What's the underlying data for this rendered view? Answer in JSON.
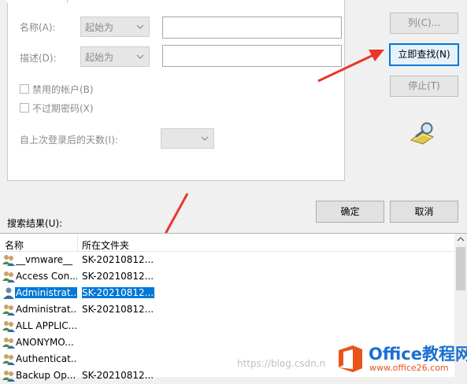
{
  "search_form": {
    "name_label": "名称(A):",
    "desc_label": "描述(D):",
    "name_mode": "起始为",
    "desc_mode": "起始为",
    "name_value": "",
    "desc_value": "",
    "disabled_accounts": "禁用的帐户(B)",
    "non_expiring_pwd": "不过期密码(X)",
    "days_since_login_label": "自上次登录后的天数(I):",
    "days_value": ""
  },
  "side_buttons": {
    "columns": "列(C)...",
    "find_now": "立即查找(N)",
    "stop": "停止(T)"
  },
  "dialog_buttons": {
    "ok": "确定",
    "cancel": "取消"
  },
  "results": {
    "label": "搜索结果(U):",
    "headers": [
      "名称",
      "所在文件夹"
    ],
    "rows": [
      {
        "name": "__vmware__",
        "folder": "SK-20210812..."
      },
      {
        "name": "Access Con...",
        "folder": "SK-20210812..."
      },
      {
        "name": "Administrat...",
        "folder": "SK-20210812..."
      },
      {
        "name": "Administrat...",
        "folder": "SK-20210812..."
      },
      {
        "name": "ALL APPLIC...",
        "folder": ""
      },
      {
        "name": "ANONYMO...",
        "folder": ""
      },
      {
        "name": "Authenticat...",
        "folder": ""
      },
      {
        "name": "Backup Op...",
        "folder": "SK-20210812..."
      }
    ]
  },
  "watermark": {
    "url_text": "https://blog.csdn.n",
    "logo_main": "Office教程网",
    "logo_url": "www.office26.com"
  },
  "colors": {
    "accent": "#0078d7",
    "annotation_arrow": "#e8372c",
    "logo_orange": "#e8541c",
    "logo_blue": "#1a6fd1"
  }
}
